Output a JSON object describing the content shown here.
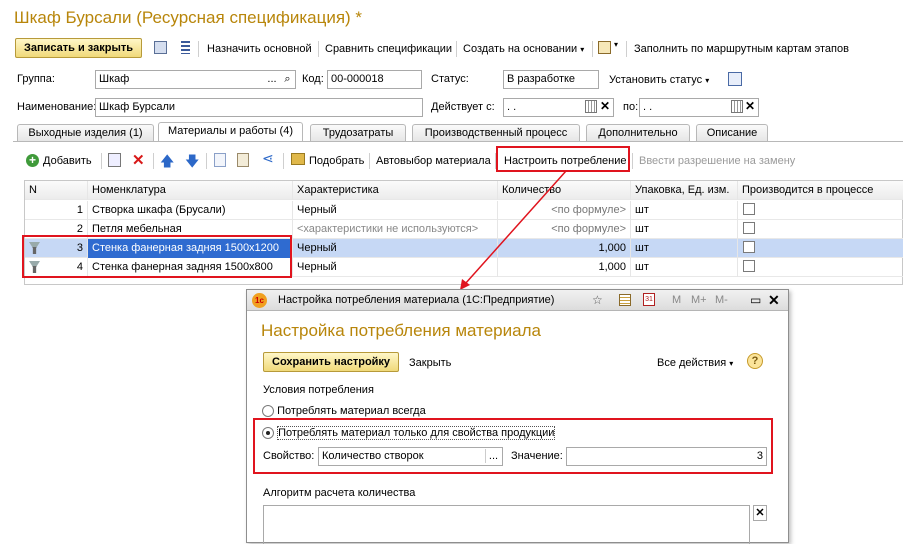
{
  "window": {
    "title": "Шкаф Бурсали (Ресурсная спецификация) *"
  },
  "toolbar": {
    "save_close": "Записать и закрыть",
    "set_main": "Назначить основной",
    "compare": "Сравнить спецификации",
    "create_based": "Создать на основании",
    "fill_route": "Заполнить по маршрутным картам этапов"
  },
  "header": {
    "group_label": "Группа:",
    "group_value": "Шкаф",
    "code_label": "Код:",
    "code_value": "00-000018",
    "status_label": "Статус:",
    "status_value": "В разработке",
    "set_status": "Установить статус",
    "name_label": "Наименование:",
    "name_value": "Шкаф Бурсали",
    "valid_from_label": "Действует с:",
    "valid_from_value": ".  .",
    "valid_to_label": "по:",
    "valid_to_value": ".  ."
  },
  "tabs": [
    {
      "label": "Выходные изделия (1)"
    },
    {
      "label": "Материалы и работы (4)"
    },
    {
      "label": "Трудозатраты"
    },
    {
      "label": "Производственный процесс"
    },
    {
      "label": "Дополнительно"
    },
    {
      "label": "Описание"
    }
  ],
  "table_toolbar": {
    "add": "Добавить",
    "pick": "Подобрать",
    "auto_select": "Автовыбор материала",
    "configure": "Настроить потребление",
    "permission": "Ввести разрешение на замену"
  },
  "table": {
    "columns": [
      "N",
      "Номенклатура",
      "Характеристика",
      "Количество",
      "Упаковка, Ед. изм.",
      "Производится в процессе"
    ],
    "rows": [
      {
        "n": "1",
        "item": "Створка шкафа (Брусали)",
        "char": "Черный",
        "qty": "<по формуле>",
        "unit": "шт"
      },
      {
        "n": "2",
        "item": "Петля мебельная",
        "char": "<характеристики не используются>",
        "qty": "<по формуле>",
        "unit": "шт"
      },
      {
        "n": "3",
        "item": "Стенка фанерная задняя 1500х1200",
        "char": "Черный",
        "qty": "1,000",
        "unit": "шт"
      },
      {
        "n": "4",
        "item": "Стенка фанерная задняя 1500х800",
        "char": "Черный",
        "qty": "1,000",
        "unit": "шт"
      }
    ]
  },
  "dialog": {
    "window_title": "Настройка потребления материала  (1С:Предприятие)",
    "heading": "Настройка потребления материала",
    "save": "Сохранить настройку",
    "close": "Закрыть",
    "all_actions": "Все действия",
    "conditions_label": "Условия потребления",
    "option_always": "Потреблять материал всегда",
    "option_property": "Потреблять материал только для свойства продукции",
    "property_label": "Свойство:",
    "property_value": "Количество створок",
    "value_label": "Значение:",
    "value_value": "3",
    "algorithm_label": "Алгоритм расчета количества",
    "m_buttons": [
      "M",
      "M+",
      "M-"
    ]
  },
  "colors": {
    "title": "#b8860b",
    "highlight": "#e0141e",
    "selected_row": "#c6d8f5"
  }
}
